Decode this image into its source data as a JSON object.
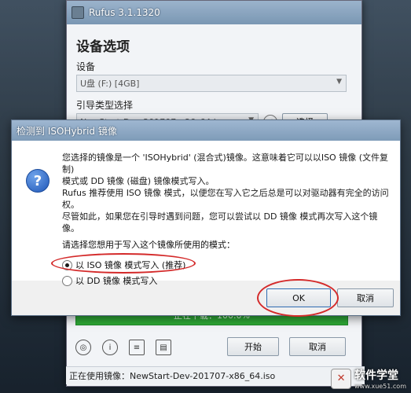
{
  "rufus": {
    "title": "Rufus 3.1.1320",
    "section_title": "设备选项",
    "device_label": "设备",
    "device_value": "U盘 (F:) [4GB]",
    "boot_label": "引导类型选择",
    "boot_value": "NewStart-Dev-201707-x86_64.iso",
    "select_button": "选择",
    "progress_text": "正在下载：100.0%",
    "start_button": "开始",
    "cancel_button": "取消",
    "status_text": "正在使用镜像：NewStart-Dev-201707-x86_64.iso"
  },
  "dialog": {
    "title": "检测到 ISOHybrid 镜像",
    "lines": [
      "您选择的镜像是一个 'ISOHybrid' (混合式)镜像。这意味着它可以以ISO 镜像 (文件复制)",
      "模式或 DD 镜像 (磁盘) 镜像模式写入。",
      "Rufus 推荐使用 ISO 镜像 模式，以便您在写入它之后总是可以对驱动器有完全的访问",
      "权。",
      "尽管如此，如果您在引导时遇到问题，您可以尝试以 DD 镜像 模式再次写入这个镜像。"
    ],
    "prompt": "请选择您想用于写入这个镜像所使用的模式：",
    "option_iso": "以 ISO 镜像 模式写入 (推荐)",
    "option_dd": "以 DD 镜像 模式写入",
    "ok_button": "OK",
    "cancel_button": "取消"
  },
  "watermark": {
    "text": "软件学堂",
    "sub": "www.xue51.com"
  },
  "colors": {
    "progress": "#2ea836",
    "highlight": "#d42a2a"
  }
}
